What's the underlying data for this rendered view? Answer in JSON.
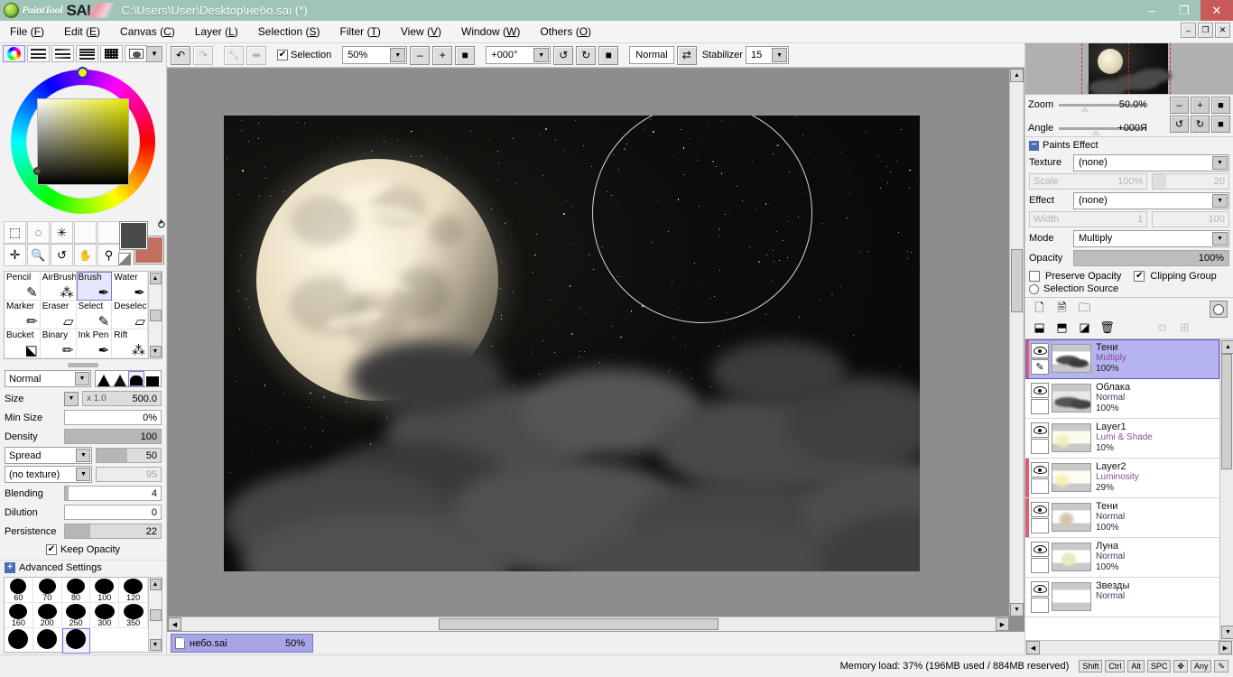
{
  "titlebar": {
    "logo_paint": "PaintTool",
    "logo_sai": "SAI",
    "path": "C:\\Users\\User\\Desktop\\небо.sai (*)",
    "minimize": "–",
    "maximize": "❐",
    "close": "✕"
  },
  "menubar": {
    "items": [
      {
        "label": "File (F)",
        "pre": "File (",
        "key": "F"
      },
      {
        "label": "Edit (E)",
        "pre": "Edit (",
        "key": "E"
      },
      {
        "label": "Canvas (C)",
        "pre": "Canvas (",
        "key": "C"
      },
      {
        "label": "Layer (L)",
        "pre": "Layer (",
        "key": "L"
      },
      {
        "label": "Selection (S)",
        "pre": "Selection (",
        "key": "S"
      },
      {
        "label": "Filter (T)",
        "pre": "Filter (",
        "key": "T"
      },
      {
        "label": "View (V)",
        "pre": "View (",
        "key": "V"
      },
      {
        "label": "Window (W)",
        "pre": "Window (",
        "key": "W"
      },
      {
        "label": "Others (O)",
        "pre": "Others (",
        "key": "O"
      }
    ],
    "win_minimize": "–",
    "win_restore": "❐",
    "win_close": "✕"
  },
  "toolbar": {
    "undo": "↶",
    "redo": "↷",
    "crop": "⤡",
    "flip": "⬌",
    "selection_label": "Selection",
    "selection_checked": true,
    "zoom_value": "50%",
    "zoom_out": "–",
    "zoom_in": "+",
    "zoom_reset": "■",
    "angle_value": "+000°",
    "rotate_ccw": "↺",
    "rotate_cw": "↻",
    "rotate_reset": "■",
    "mode_value": "Normal",
    "swap_icon": "⇄",
    "stabilizer_label": "Stabilizer",
    "stabilizer_value": "15",
    "dropdown_arrow": "▼"
  },
  "left_panel": {
    "color_modes": [
      {
        "name": "wheel",
        "selected": true
      },
      {
        "name": "rgb-slider",
        "selected": false
      },
      {
        "name": "hsv-slider",
        "selected": false
      },
      {
        "name": "swatch-list",
        "selected": false
      },
      {
        "name": "swatch-grid",
        "selected": false
      },
      {
        "name": "scratchpad",
        "selected": false
      }
    ],
    "panel_dropdown": "▼",
    "color_fg": "#4a4a4a",
    "color_bg": "#c0705e",
    "swap_icon": "⥁",
    "tools_top_row1": [
      "rect-select-icon",
      "lasso-select-icon",
      "magic-wand-icon",
      "blank-tool-1",
      "blank-tool-2"
    ],
    "tools_top_row2": [
      "move-icon",
      "zoom-icon",
      "rotate-icon",
      "hand-icon",
      "eyedropper-icon"
    ],
    "tool_grid": [
      {
        "label": "Pencil",
        "glyph": "✎",
        "selected": false
      },
      {
        "label": "AirBrush",
        "glyph": "⁂",
        "selected": false
      },
      {
        "label": "Brush",
        "glyph": "✒",
        "selected": true
      },
      {
        "label": "Water",
        "glyph": "✒",
        "selected": false
      },
      {
        "label": "Marker",
        "glyph": "✏",
        "selected": false
      },
      {
        "label": "Eraser",
        "glyph": "▱",
        "selected": false
      },
      {
        "label": "Select",
        "glyph": "✎",
        "selected": false
      },
      {
        "label": "Deselect",
        "glyph": "▱",
        "selected": false
      },
      {
        "label": "Bucket",
        "glyph": "⬕",
        "selected": false
      },
      {
        "label": "Binary",
        "glyph": "✏",
        "selected": false
      },
      {
        "label": "Ink Pen",
        "glyph": "✒",
        "selected": false
      },
      {
        "label": "Rift",
        "glyph": "⁂",
        "selected": false
      }
    ],
    "brush": {
      "blend_mode": "Normal",
      "shapes": [
        "sharp-triangle",
        "soft-triangle",
        "dome",
        "square"
      ],
      "shape_selected": 2,
      "size_label": "Size",
      "size_mult": "x 1.0",
      "size_value": "500.0",
      "minsize_label": "Min Size",
      "minsize_value": "0%",
      "density_label": "Density",
      "density_value": "100",
      "spread_label": "Spread",
      "spread_value": "50",
      "texture_label": "(no texture)",
      "texture_value": "95",
      "blending_label": "Blending",
      "blending_value": "4",
      "dilution_label": "Dilution",
      "dilution_value": "0",
      "persistence_label": "Persistence",
      "persistence_value": "22",
      "keep_opacity_label": "Keep Opacity",
      "keep_opacity_checked": true,
      "advanced_label": "Advanced Settings"
    },
    "presets": [
      {
        "label": "60",
        "size": 18,
        "selected": false
      },
      {
        "label": "70",
        "size": 19,
        "selected": false
      },
      {
        "label": "80",
        "size": 20,
        "selected": false
      },
      {
        "label": "100",
        "size": 21,
        "selected": false
      },
      {
        "label": "120",
        "size": 21,
        "selected": false
      },
      {
        "label": "160",
        "size": 20,
        "selected": false
      },
      {
        "label": "200",
        "size": 21,
        "selected": false
      },
      {
        "label": "250",
        "size": 22,
        "selected": false
      },
      {
        "label": "300",
        "size": 22,
        "selected": false
      },
      {
        "label": "350",
        "size": 22,
        "selected": false
      },
      {
        "label": "",
        "size": 22,
        "selected": false
      },
      {
        "label": "",
        "size": 22,
        "selected": false
      },
      {
        "label": "",
        "size": 22,
        "selected": true
      }
    ]
  },
  "canvas": {
    "artwork_description": "night-sky-moon-clouds",
    "tab_name": "небо.sai",
    "tab_zoom": "50%",
    "scroll_left": "◀",
    "scroll_right": "▶",
    "scroll_up": "▲",
    "scroll_down": "▼"
  },
  "right_panel": {
    "navigator": {
      "zoom_label": "Zoom",
      "zoom_value": "50.0%",
      "angle_label": "Angle",
      "angle_value": "+000Я",
      "btn_zoom_out": "–",
      "btn_zoom_in": "+",
      "btn_zoom_reset": "■",
      "btn_rot_ccw": "↺",
      "btn_rot_cw": "↻",
      "btn_rot_reset": "■"
    },
    "paints_effect": {
      "title": "Paints Effect",
      "collapse_icon": "−",
      "texture_label": "Texture",
      "texture_value": "(none)",
      "scale_label": "Scale",
      "scale_value": "100%",
      "scale_num": "20",
      "effect_label": "Effect",
      "effect_value": "(none)",
      "width_label": "Width",
      "width_value": "1",
      "width_num": "100"
    },
    "layer_props": {
      "mode_label": "Mode",
      "mode_value": "Multiply",
      "opacity_label": "Opacity",
      "opacity_value": "100%",
      "preserve_opacity_label": "Preserve Opacity",
      "preserve_opacity_checked": false,
      "clipping_group_label": "Clipping Group",
      "clipping_group_checked": true,
      "selection_source_label": "Selection Source",
      "selection_source_checked": false
    },
    "layer_tools": {
      "new_layer": "new-layer-icon",
      "new_linework": "new-linework-layer-icon",
      "new_folder": "new-folder-icon",
      "merge_down": "merge-down-icon",
      "merge_copy": "merge-copy-icon",
      "clear_layer": "clear-layer-icon",
      "delete_layer": "delete-layer-icon",
      "clipping_icon": "clipping-icon",
      "mask_icon": "mask-icon",
      "selection_circle": "selection-source-icon"
    },
    "layers": [
      {
        "name": "Тени",
        "mode": "Multiply",
        "opacity": "100%",
        "selected": true,
        "marked": true,
        "visible": true,
        "has_pen": true,
        "thumb": "clouds-dark"
      },
      {
        "name": "Облака",
        "mode": "Normal",
        "opacity": "100%",
        "selected": false,
        "marked": false,
        "visible": true,
        "has_pen": false,
        "thumb": "clouds-gray"
      },
      {
        "name": "Layer1",
        "mode": "Lumi & Shade",
        "opacity": "10%",
        "selected": false,
        "marked": false,
        "visible": true,
        "has_pen": false,
        "thumb": "glow-pale"
      },
      {
        "name": "Layer2",
        "mode": "Luminosity",
        "opacity": "29%",
        "selected": false,
        "marked": true,
        "visible": true,
        "has_pen": false,
        "thumb": "glow-yellow"
      },
      {
        "name": "Тени",
        "mode": "Normal",
        "opacity": "100%",
        "selected": false,
        "marked": true,
        "visible": true,
        "has_pen": false,
        "thumb": "moon-shade"
      },
      {
        "name": "Луна",
        "mode": "Normal",
        "opacity": "100%",
        "selected": false,
        "marked": false,
        "visible": true,
        "has_pen": false,
        "thumb": "moon"
      },
      {
        "name": "Звезды",
        "mode": "Normal",
        "opacity": "",
        "selected": false,
        "marked": false,
        "visible": true,
        "has_pen": false,
        "thumb": "stars"
      }
    ]
  },
  "statusbar": {
    "memory": "Memory load: 37% (196MB used / 884MB reserved)",
    "keys": [
      "Shift",
      "Ctrl",
      "Alt",
      "SPC"
    ],
    "nav_icon": "✥",
    "any_label": "Any",
    "pen_icon": "✎"
  }
}
